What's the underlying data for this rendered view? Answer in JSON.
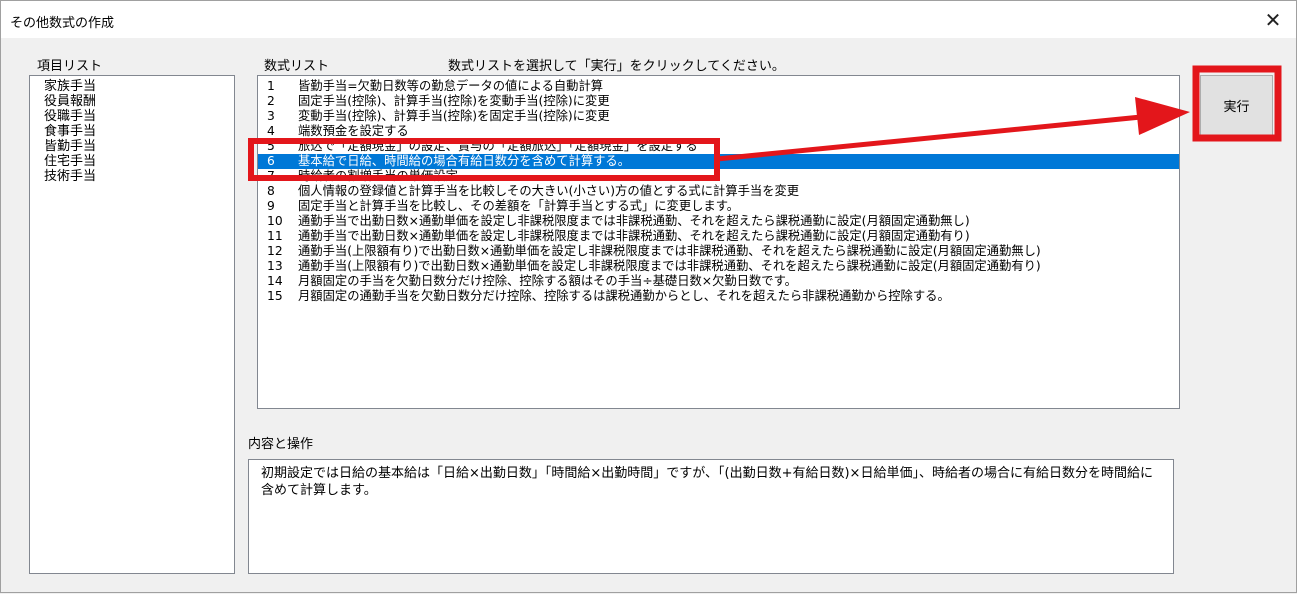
{
  "window": {
    "title": "その他数式の作成",
    "close_glyph": "✕"
  },
  "item_list": {
    "label": "項目リスト",
    "items": [
      "家族手当",
      "役員報酬",
      "役職手当",
      "食事手当",
      "皆勤手当",
      "住宅手当",
      "技術手当"
    ]
  },
  "formula_list": {
    "label": "数式リスト",
    "instruction": "数式リストを選択して「実行」をクリックしてください。",
    "selected_index": 6,
    "rows": [
      {
        "num": "1",
        "text": "皆勤手当=欠勤日数等の勤怠データの値による自動計算"
      },
      {
        "num": "2",
        "text": "固定手当(控除)、計算手当(控除)を変動手当(控除)に変更"
      },
      {
        "num": "3",
        "text": "変動手当(控除)、計算手当(控除)を固定手当(控除)に変更"
      },
      {
        "num": "4",
        "text": "端数預金を設定する"
      },
      {
        "num": "5",
        "text": "旅込で「定額現金」の設定、賞与の「定額旅込」「定額現金」を設定する"
      },
      {
        "num": "6",
        "text": "基本給で日給、時間給の場合有給日数分を含めて計算する。"
      },
      {
        "num": "7",
        "text": "時給者の割増手当の単価設定"
      },
      {
        "num": "8",
        "text": "個人情報の登録値と計算手当を比較しその大きい(小さい)方の値とする式に計算手当を変更"
      },
      {
        "num": "9",
        "text": "固定手当と計算手当を比較し、その差額を「計算手当とする式」に変更します。"
      },
      {
        "num": "10",
        "text": "通勤手当で出勤日数×通勤単価を設定し非課税限度までは非課税通勤、それを超えたら課税通勤に設定(月額固定通勤無し)"
      },
      {
        "num": "11",
        "text": "通勤手当で出勤日数×通勤単価を設定し非課税限度までは非課税通勤、それを超えたら課税通勤に設定(月額固定通勤有り)"
      },
      {
        "num": "12",
        "text": "通勤手当(上限額有り)で出勤日数×通勤単価を設定し非課税限度までは非課税通勤、それを超えたら課税通勤に設定(月額固定通勤無し)"
      },
      {
        "num": "13",
        "text": "通勤手当(上限額有り)で出勤日数×通勤単価を設定し非課税限度までは非課税通勤、それを超えたら課税通勤に設定(月額固定通勤有り)"
      },
      {
        "num": "14",
        "text": "月額固定の手当を欠勤日数分だけ控除、控除する額はその手当÷基礎日数×欠勤日数です。"
      },
      {
        "num": "15",
        "text": "月額固定の通勤手当を欠勤日数分だけ控除、控除するは課税通勤からとし、それを超えたら非課税通勤から控除する。"
      }
    ]
  },
  "execute_button": {
    "label": "実行"
  },
  "description": {
    "label": "内容と操作",
    "text": "初期設定では日給の基本給は「日給×出勤日数」「時間給×出勤時間」ですが、「(出勤日数+有給日数)×日給単価」、時給者の場合に有給日数分を時間給に含めて計算します。"
  },
  "annotation": {
    "color": "#e3161b"
  }
}
